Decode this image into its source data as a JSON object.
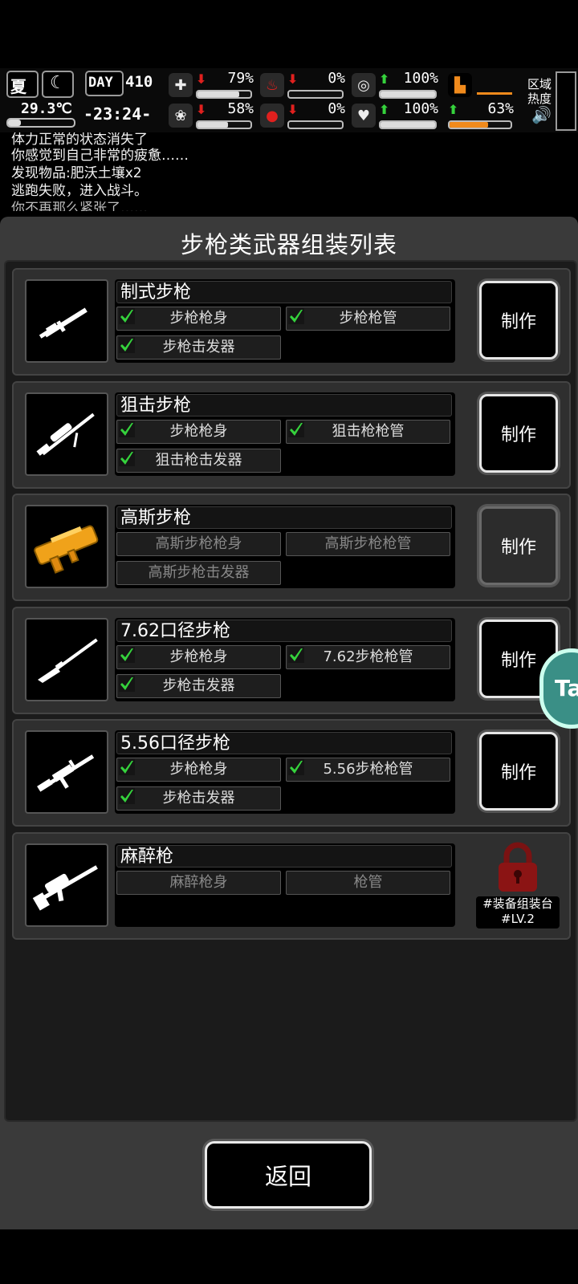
{
  "hud": {
    "season": "夏",
    "temperature": "29.3℃",
    "day_label": "DAY",
    "day_number": "410",
    "clock": "-23:24-",
    "zone_label_line1": "区域",
    "zone_label_line2": "热度",
    "stats": [
      {
        "name": "health",
        "icon": "medkit-icon",
        "arrow": "down",
        "value": "79%",
        "fraction": 0.79
      },
      {
        "name": "hunger",
        "icon": "stomach-icon",
        "arrow": "down",
        "value": "0%",
        "fraction": 0.0
      },
      {
        "name": "hygiene",
        "icon": "soap-icon",
        "arrow": "up",
        "value": "100%",
        "fraction": 1.0
      },
      {
        "name": "stamina",
        "icon": "boot-icon",
        "arrow": "",
        "value": "",
        "fraction": 0.0
      },
      {
        "name": "mind",
        "icon": "brain-icon",
        "arrow": "down",
        "value": "58%",
        "fraction": 0.58
      },
      {
        "name": "thirst",
        "icon": "water-drop-icon",
        "arrow": "down",
        "value": "0%",
        "fraction": 0.0
      },
      {
        "name": "mood",
        "icon": "heart-icon",
        "arrow": "up",
        "value": "100%",
        "fraction": 1.0
      },
      {
        "name": "energy",
        "icon": "boot-icon",
        "arrow": "up",
        "value": "63%",
        "fraction": 0.63
      }
    ]
  },
  "log": [
    "体力正常的状态消失了",
    "你感觉到自己非常的疲惫……",
    "发现物品:肥沃土壤x2",
    "逃跑失败，进入战斗。",
    "你不再那么紧张了……"
  ],
  "panel": {
    "title": "步枪类武器组装列表",
    "craft_label": "制作",
    "weapons": [
      {
        "name": "制式步枪",
        "icon": "assault-rifle-icon",
        "parts": [
          {
            "label": "步枪枪身",
            "owned": true
          },
          {
            "label": "步枪枪管",
            "owned": true
          },
          {
            "label": "步枪击发器",
            "owned": true
          }
        ],
        "craftable": true
      },
      {
        "name": "狙击步枪",
        "icon": "sniper-rifle-icon",
        "parts": [
          {
            "label": "步枪枪身",
            "owned": true
          },
          {
            "label": "狙击枪枪管",
            "owned": true
          },
          {
            "label": "狙击枪击发器",
            "owned": true
          }
        ],
        "craftable": true
      },
      {
        "name": "高斯步枪",
        "icon": "gauss-rifle-icon",
        "parts": [
          {
            "label": "高斯步枪枪身",
            "owned": false
          },
          {
            "label": "高斯步枪枪管",
            "owned": false
          },
          {
            "label": "高斯步枪击发器",
            "owned": false
          }
        ],
        "craftable": false
      },
      {
        "name": "7.62口径步枪",
        "icon": "bolt-rifle-icon",
        "parts": [
          {
            "label": "步枪枪身",
            "owned": true
          },
          {
            "label": "7.62步枪枪管",
            "owned": true
          },
          {
            "label": "步枪击发器",
            "owned": true
          }
        ],
        "craftable": true
      },
      {
        "name": "5.56口径步枪",
        "icon": "m16-rifle-icon",
        "parts": [
          {
            "label": "步枪枪身",
            "owned": true
          },
          {
            "label": "5.56步枪枪管",
            "owned": true
          },
          {
            "label": "步枪击发器",
            "owned": true
          }
        ],
        "craftable": true
      },
      {
        "name": "麻醉枪",
        "icon": "tranquilizer-gun-icon",
        "parts": [
          {
            "label": "麻醉枪身",
            "owned": false
          },
          {
            "label": "枪管",
            "owned": false
          }
        ],
        "craftable": false,
        "locked": true,
        "lock_requirement_line1": "#装备组装台",
        "lock_requirement_line2": "#LV.2"
      }
    ]
  },
  "back_label": "返回",
  "float_button_label": "Ta",
  "colors": {
    "accent_green": "#35d23c",
    "alert_red": "#e0201e",
    "gauss_orange": "#f0a21a",
    "lock_red": "#8b1414"
  }
}
